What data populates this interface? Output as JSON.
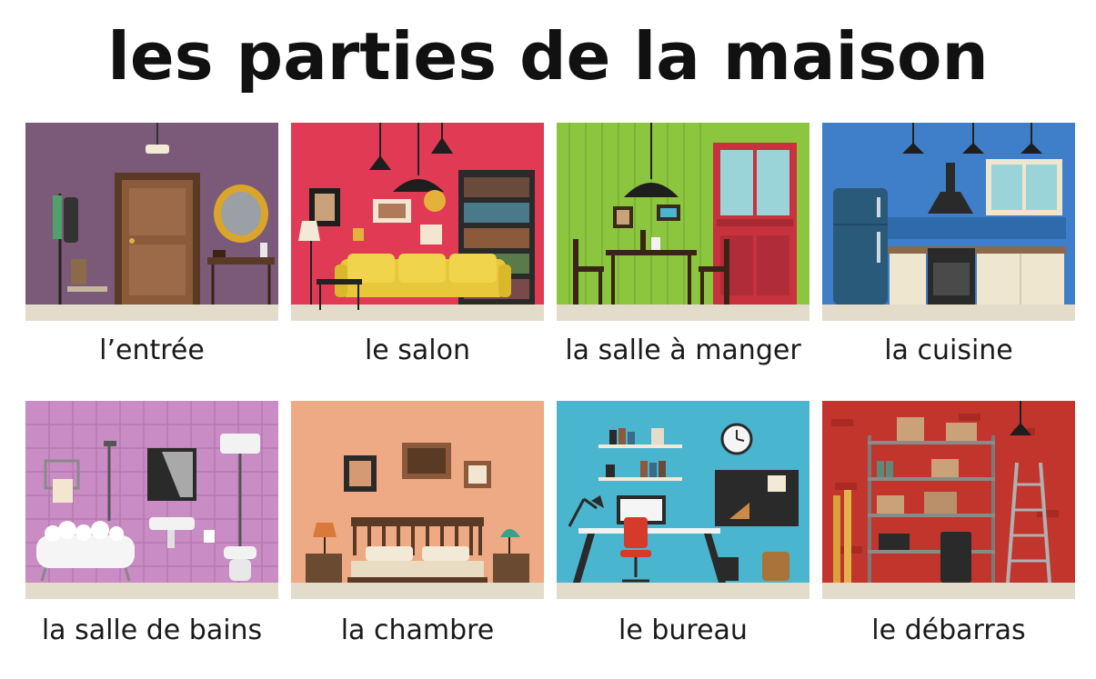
{
  "title": "les parties de la maison",
  "rooms": [
    {
      "label": "l’entrée"
    },
    {
      "label": "le salon"
    },
    {
      "label": "la salle à manger"
    },
    {
      "label": "la cuisine"
    },
    {
      "label": "la salle de bains"
    },
    {
      "label": "la chambre"
    },
    {
      "label": "le bureau"
    },
    {
      "label": "le débarras"
    }
  ],
  "colors": {
    "entree_wall": "#7a5a78",
    "salon_wall": "#e03a55",
    "salle_a_manger_wall": "#8cc63f",
    "cuisine_wall": "#3f7fc9",
    "salle_de_bains_wall": "#c98cc4",
    "chambre_wall": "#eeaa84",
    "bureau_wall": "#4ab5cf",
    "debarras_wall": "#c2352c",
    "floor": "#e4dccb"
  }
}
